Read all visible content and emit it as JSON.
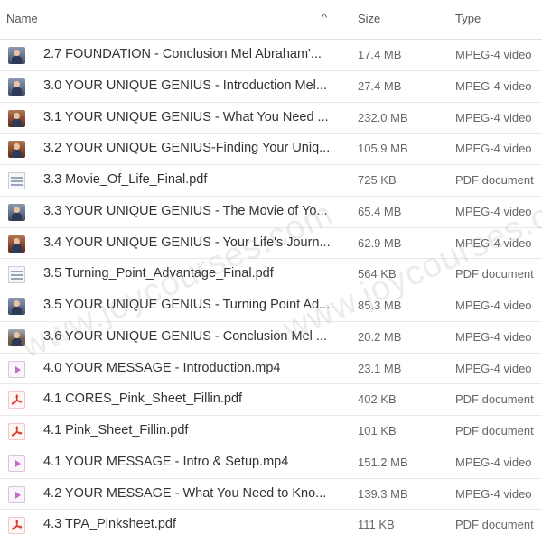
{
  "header": {
    "name": "Name",
    "size": "Size",
    "type": "Type",
    "sort_indicator": "^"
  },
  "watermark": "www.joycourses.com",
  "files": [
    {
      "name": "2.7 FOUNDATION - Conclusion Mel Abraham'...",
      "size": "17.4 MB",
      "type": "MPEG-4 video",
      "icon": "video-thumbnail-icon"
    },
    {
      "name": "3.0 YOUR UNIQUE GENIUS - Introduction Mel...",
      "size": "27.4 MB",
      "type": "MPEG-4 video",
      "icon": "video-thumbnail-icon"
    },
    {
      "name": "3.1 YOUR UNIQUE GENIUS - What You Need ...",
      "size": "232.0 MB",
      "type": "MPEG-4 video",
      "icon": "video-thumbnail-icon"
    },
    {
      "name": "3.2 YOUR UNIQUE GENIUS-Finding Your Uniq...",
      "size": "105.9 MB",
      "type": "MPEG-4 video",
      "icon": "video-thumbnail-icon"
    },
    {
      "name": "3.3 Movie_Of_Life_Final.pdf",
      "size": "725 KB",
      "type": "PDF document",
      "icon": "pdf-thumbnail-icon"
    },
    {
      "name": "3.3 YOUR UNIQUE GENIUS - The Movie of Yo...",
      "size": "65.4 MB",
      "type": "MPEG-4 video",
      "icon": "video-thumbnail-icon"
    },
    {
      "name": "3.4 YOUR UNIQUE GENIUS - Your Life's Journ...",
      "size": "62.9 MB",
      "type": "MPEG-4 video",
      "icon": "video-thumbnail-icon"
    },
    {
      "name": "3.5 Turning_Point_Advantage_Final.pdf",
      "size": "564 KB",
      "type": "PDF document",
      "icon": "pdf-thumbnail-icon"
    },
    {
      "name": "3.5 YOUR UNIQUE GENIUS - Turning Point Ad...",
      "size": "85.3 MB",
      "type": "MPEG-4 video",
      "icon": "video-thumbnail-icon"
    },
    {
      "name": "3.6 YOUR UNIQUE GENIUS - Conclusion Mel ...",
      "size": "20.2 MB",
      "type": "MPEG-4 video",
      "icon": "video-thumbnail-icon"
    },
    {
      "name": "4.0 YOUR MESSAGE - Introduction.mp4",
      "size": "23.1 MB",
      "type": "MPEG-4 video",
      "icon": "video-file-icon"
    },
    {
      "name": "4.1 CORES_Pink_Sheet_Fillin.pdf",
      "size": "402 KB",
      "type": "PDF document",
      "icon": "pdf-file-icon"
    },
    {
      "name": "4.1 Pink_Sheet_Fillin.pdf",
      "size": "101 KB",
      "type": "PDF document",
      "icon": "pdf-file-icon"
    },
    {
      "name": "4.1 YOUR MESSAGE - Intro & Setup.mp4",
      "size": "151.2 MB",
      "type": "MPEG-4 video",
      "icon": "video-file-icon"
    },
    {
      "name": "4.2 YOUR MESSAGE - What You Need to Kno...",
      "size": "139.3 MB",
      "type": "MPEG-4 video",
      "icon": "video-file-icon"
    },
    {
      "name": "4.3 TPA_Pinksheet.pdf",
      "size": "111 KB",
      "type": "PDF document",
      "icon": "pdf-file-icon"
    }
  ]
}
